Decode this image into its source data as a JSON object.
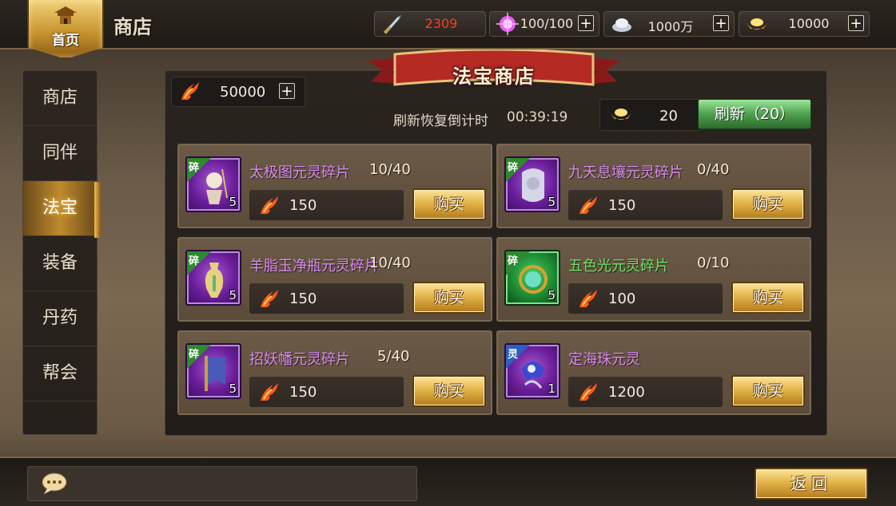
{
  "header": {
    "home_label": "首页",
    "title": "商店",
    "resources": [
      {
        "icon": "sword-icon",
        "value": "2309",
        "color": "#ff3a2a"
      },
      {
        "icon": "magic-orb-icon",
        "value": "100/100",
        "color": "#eae4d8"
      },
      {
        "icon": "silver-icon",
        "value": "1000万",
        "color": "#eae4d8"
      },
      {
        "icon": "gold-ingot-icon",
        "value": "10000",
        "color": "#eae4d8"
      }
    ],
    "plus_label": "+"
  },
  "sidebar": {
    "tabs": [
      {
        "label": "商店",
        "active": false
      },
      {
        "label": "同伴",
        "active": false
      },
      {
        "label": "法宝",
        "active": true
      },
      {
        "label": "装备",
        "active": false
      },
      {
        "label": "丹药",
        "active": false
      },
      {
        "label": "帮会",
        "active": false
      }
    ]
  },
  "shop": {
    "banner_title": "法宝商店",
    "currency_amount": "50000",
    "refresh_countdown_label": "刷新恢复倒计时",
    "refresh_countdown_time": "00:39:19",
    "refresh_cost": "20",
    "refresh_button_label": "刷新（20）",
    "buy_label": "购买",
    "items": [
      {
        "name": "太极图元灵碎片",
        "stock": "10/40",
        "price": "150",
        "count": "5",
        "corner": "碎",
        "rarity": "purple"
      },
      {
        "name": "九天息壤元灵碎片",
        "stock": "0/40",
        "price": "150",
        "count": "5",
        "corner": "碎",
        "rarity": "purple"
      },
      {
        "name": "羊脂玉净瓶元灵碎片",
        "stock": "10/40",
        "price": "150",
        "count": "5",
        "corner": "碎",
        "rarity": "purple"
      },
      {
        "name": "五色光元灵碎片",
        "stock": "0/10",
        "price": "100",
        "count": "5",
        "corner": "碎",
        "rarity": "green"
      },
      {
        "name": "招妖幡元灵碎片",
        "stock": "5/40",
        "price": "150",
        "count": "5",
        "corner": "碎",
        "rarity": "purple"
      },
      {
        "name": "定海珠元灵",
        "stock": "",
        "price": "1200",
        "count": "1",
        "corner": "灵",
        "rarity": "purple"
      }
    ]
  },
  "footer": {
    "back_label": "返回"
  }
}
